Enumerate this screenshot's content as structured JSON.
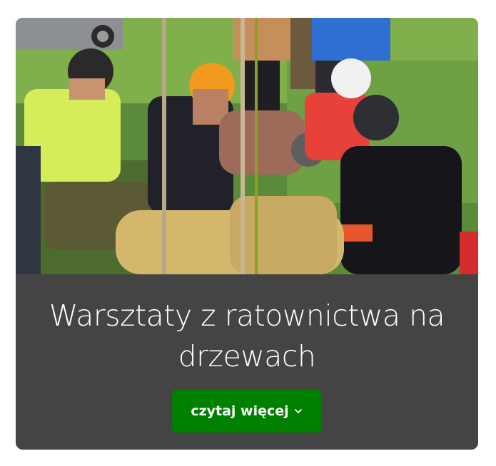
{
  "card": {
    "title": "Warsztaty z ratownictwa na drzewach",
    "button_label": "czytaj więcej",
    "button_icon": "chevron-down-icon"
  },
  "colors": {
    "caption_bg": "#444444",
    "button_bg": "#008000",
    "text": "#ffffff"
  }
}
